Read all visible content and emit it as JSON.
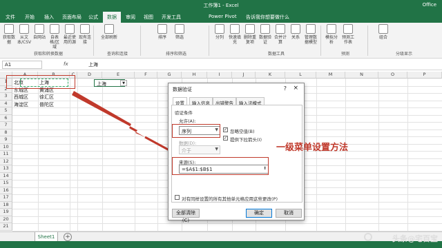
{
  "window": {
    "title": "工作簿1 - Excel",
    "brand": "Office"
  },
  "tabs": [
    "文件",
    "开始",
    "插入",
    "页面布局",
    "公式",
    "数据",
    "审阅",
    "视图",
    "开发工具",
    "Power Pivot",
    "告诉我你想要做什么"
  ],
  "active_tab": "数据",
  "ribbon": {
    "buttons": [
      "获取数据",
      "从文本/CSV",
      "自网站",
      "自表格/区域",
      "最近使用的源",
      "现有连接",
      "全部刷新",
      "排序",
      "筛选",
      "分列",
      "快速填充",
      "删除重复项",
      "数据验证",
      "合并计算",
      "关系",
      "管理数据模型",
      "模拟分析",
      "预测工作表",
      "组合"
    ],
    "groups": [
      "获取和转换数据",
      "查询和连接",
      "排序和筛选",
      "数据工具",
      "预测",
      "分级显示"
    ]
  },
  "formula_bar": {
    "name_box": "A1",
    "fx": "fx",
    "value": "上海"
  },
  "columns": [
    "A",
    "B",
    "C",
    "D",
    "E",
    "F",
    "G",
    "H",
    "I",
    "J",
    "K",
    "L",
    "M",
    "N",
    "O",
    "P"
  ],
  "rows": [
    "1",
    "2",
    "3",
    "4",
    "5",
    "6",
    "7",
    "8",
    "9",
    "10",
    "11",
    "12",
    "13",
    "14",
    "15",
    "16",
    "17",
    "18",
    "19",
    "20",
    "21"
  ],
  "cells": {
    "A1": "北京",
    "B1": "上海",
    "A2": "东城区",
    "B2": "黄浦区",
    "A3": "西城区",
    "B3": "徐汇区",
    "A4": "海淀区",
    "B4": "普陀区",
    "D1": "上海"
  },
  "dialog": {
    "title": "数据验证",
    "help": "?",
    "close": "×",
    "tabs": [
      "设置",
      "输入信息",
      "出错警告",
      "输入法模式"
    ],
    "criteria_label": "验证条件",
    "allow_label": "允许(A):",
    "allow_value": "序列",
    "ignore_blank": "忽略空值(B)",
    "dropdown": "提供下拉箭头(I)",
    "data_label": "数据(D):",
    "data_value": "介于",
    "source_label": "来源(S):",
    "source_value": "=$A$1:$B$1",
    "apply_all": "对有同样设置的所有其他单元格应用这些更改(P)",
    "clear_btn": "全部清除(C)",
    "ok_btn": "确定",
    "cancel_btn": "取消"
  },
  "annotation": "一级菜单设置方法",
  "sheet_tab": "Sheet1",
  "watermark": "头条@宅百宝",
  "colors": {
    "excel_green": "#217346",
    "annotation_red": "#c0392b"
  }
}
